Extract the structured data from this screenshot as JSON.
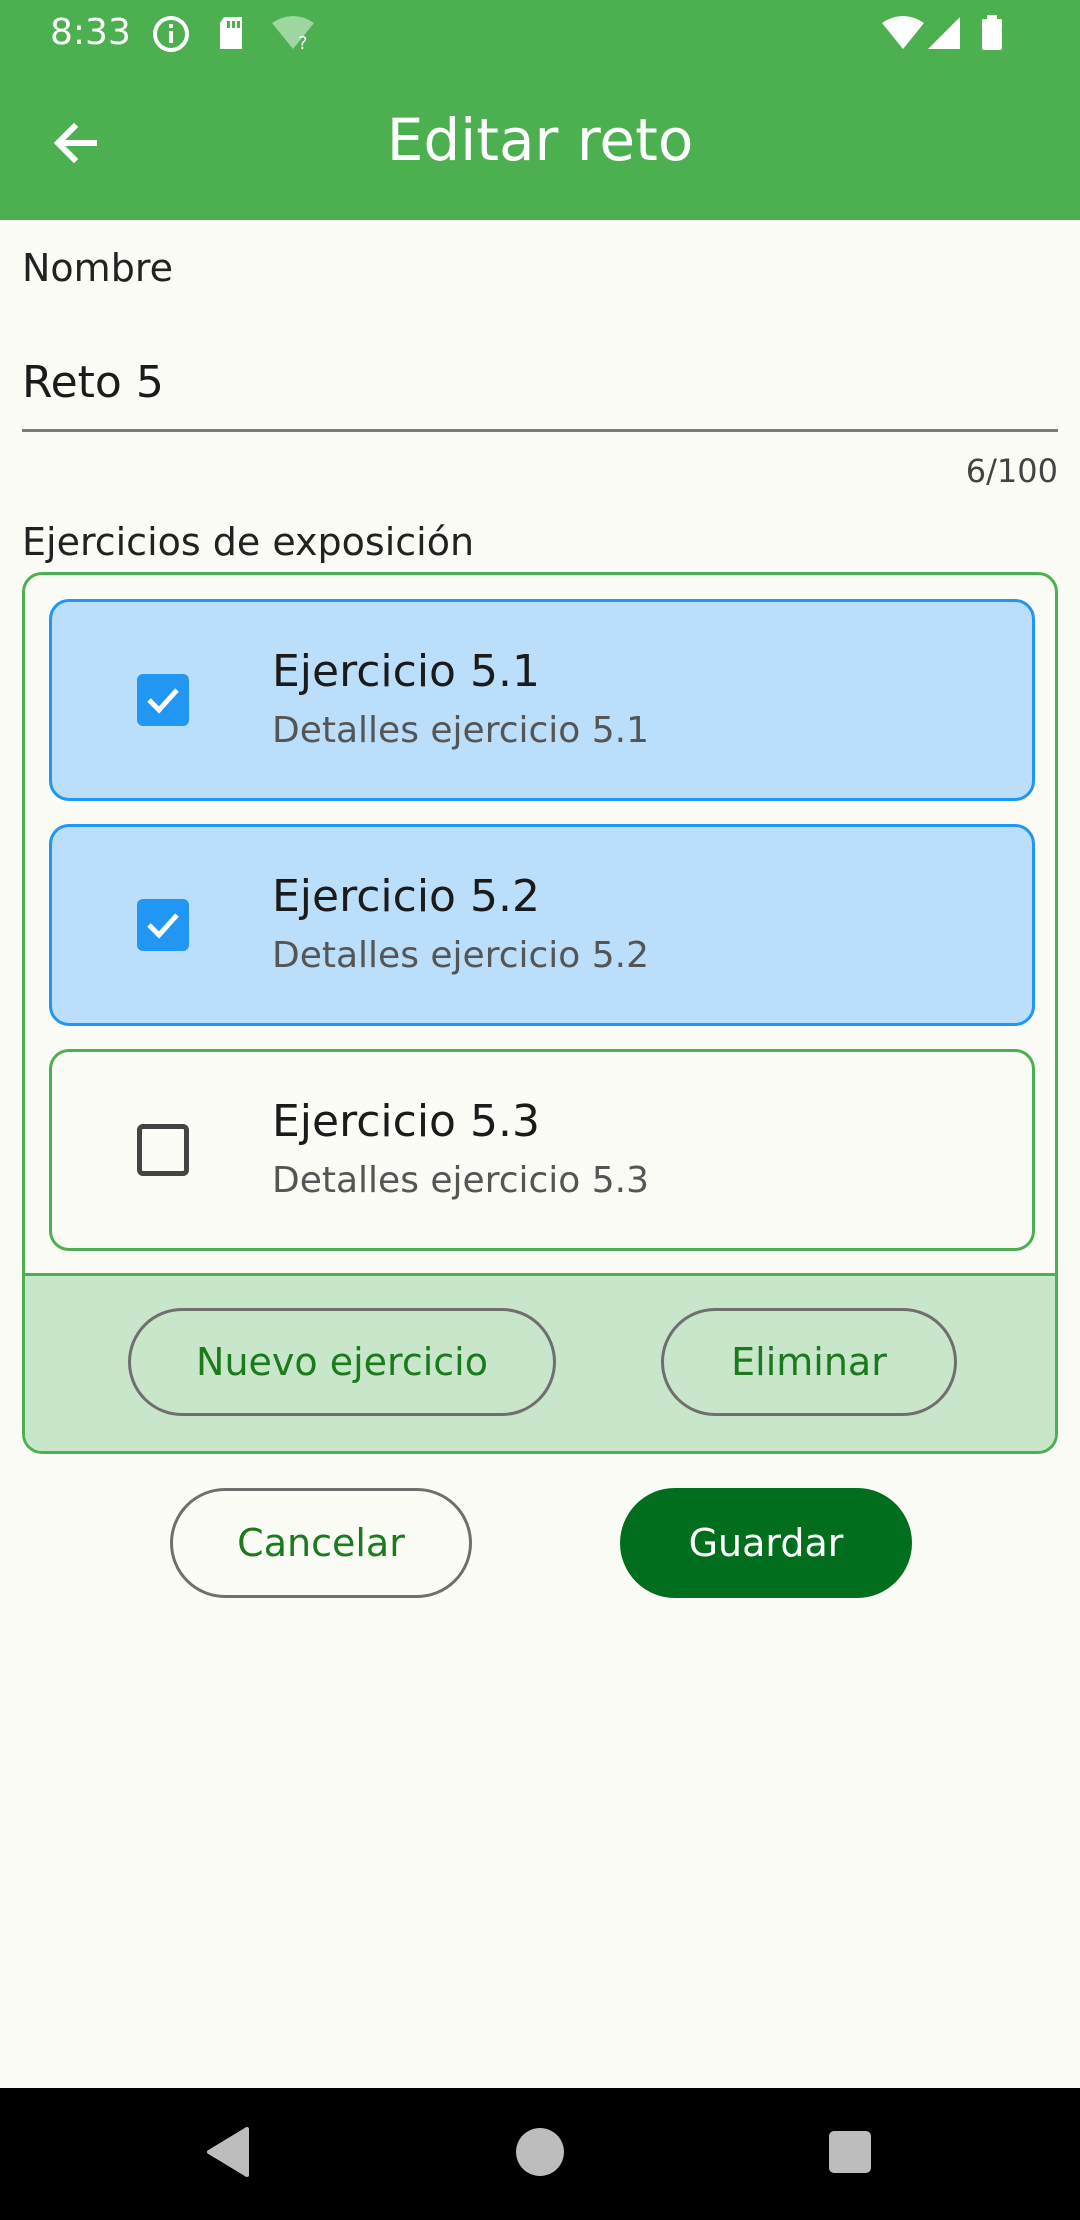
{
  "status_bar": {
    "time": "8:33",
    "left_icons": [
      "info-icon",
      "sd-card-icon",
      "wifi-question-icon"
    ],
    "right_icons": [
      "wifi-icon",
      "signal-icon",
      "battery-icon"
    ]
  },
  "app_bar": {
    "title": "Editar reto",
    "back_icon": "arrow-back-icon"
  },
  "form": {
    "name_label": "Nombre",
    "name_value": "Reto 5",
    "name_counter": "6/100",
    "exercises_label": "Ejercicios de exposición"
  },
  "exercises": [
    {
      "title": "Ejercicio 5.1",
      "detail": "Detalles ejercicio 5.1",
      "checked": true
    },
    {
      "title": "Ejercicio 5.2",
      "detail": "Detalles ejercicio 5.2",
      "checked": true
    },
    {
      "title": "Ejercicio 5.3",
      "detail": "Detalles ejercicio 5.3",
      "checked": false
    }
  ],
  "panel_actions": {
    "new_label": "Nuevo ejercicio",
    "delete_label": "Eliminar"
  },
  "actions": {
    "cancel_label": "Cancelar",
    "save_label": "Guardar"
  },
  "colors": {
    "primary": "#4CAF50",
    "selected_bg": "#BBDEFB",
    "selected_border": "#2196F3",
    "panel_footer_bg": "#C8E6C9",
    "save_bg": "#006E1C",
    "text_green": "#1B7A1B"
  },
  "nav_bar": {
    "icons": [
      "nav-back-icon",
      "nav-home-icon",
      "nav-recents-icon"
    ]
  }
}
